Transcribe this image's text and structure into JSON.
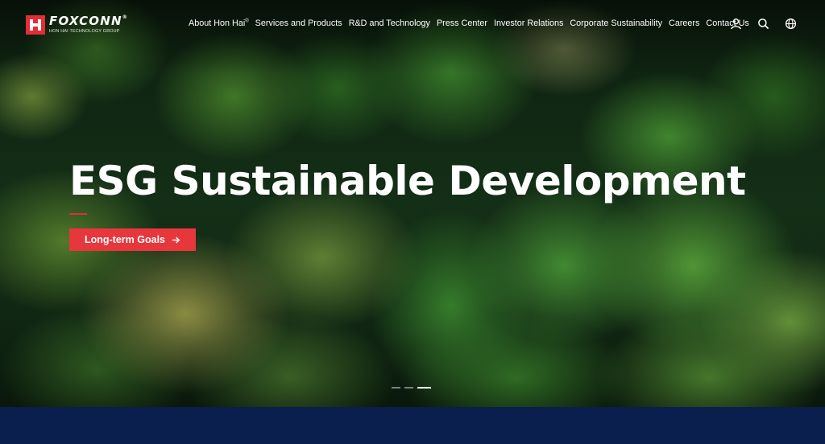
{
  "header": {
    "logo": {
      "wordmark": "FOXCONN",
      "registered": "®",
      "tagline": "HON HAI TECHNOLOGY GROUP"
    },
    "nav": [
      {
        "label": "About Hon Hai",
        "sup": "®"
      },
      {
        "label": "Services and Products"
      },
      {
        "label": "R&D and Technology"
      },
      {
        "label": "Press Center"
      },
      {
        "label": "Investor Relations"
      },
      {
        "label": "Corporate Sustainability"
      },
      {
        "label": "Careers"
      },
      {
        "label": "Contact Us"
      }
    ],
    "icons": [
      "user-icon",
      "search-icon",
      "globe-icon"
    ]
  },
  "hero": {
    "headline": "ESG Sustainable Development",
    "cta_label": "Long-term Goals",
    "slides": {
      "count": 3,
      "active_index": 2
    }
  },
  "colors": {
    "brand_red": "#e02f36",
    "navy": "#0a1f4d",
    "text": "#ffffff"
  }
}
